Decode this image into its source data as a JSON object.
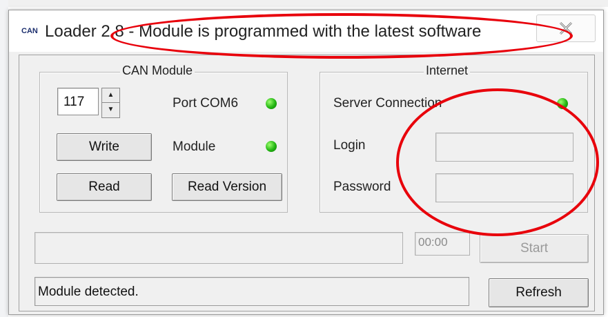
{
  "window": {
    "app_icon": "CAN",
    "title": "Loader 2.8 - Module is programmed with the latest software"
  },
  "can_module": {
    "legend": "CAN Module",
    "number_value": "117",
    "port_label": "Port COM6",
    "module_label": "Module",
    "write_label": "Write",
    "read_label": "Read",
    "read_version_label": "Read Version"
  },
  "internet": {
    "legend": "Internet",
    "server_label": "Server Connection",
    "login_label": "Login",
    "password_label": "Password",
    "login_value": "",
    "password_value": ""
  },
  "progress": {
    "time": "00:00",
    "start_label": "Start"
  },
  "status": {
    "text": "Module detected.",
    "refresh_label": "Refresh"
  },
  "icons": {
    "close": "close-icon",
    "spin_up": "spin-up-icon",
    "spin_down": "spin-down-icon",
    "status_led": "status-led-icon"
  },
  "colors": {
    "led": "#22b512",
    "annotation": "#e8000b"
  }
}
